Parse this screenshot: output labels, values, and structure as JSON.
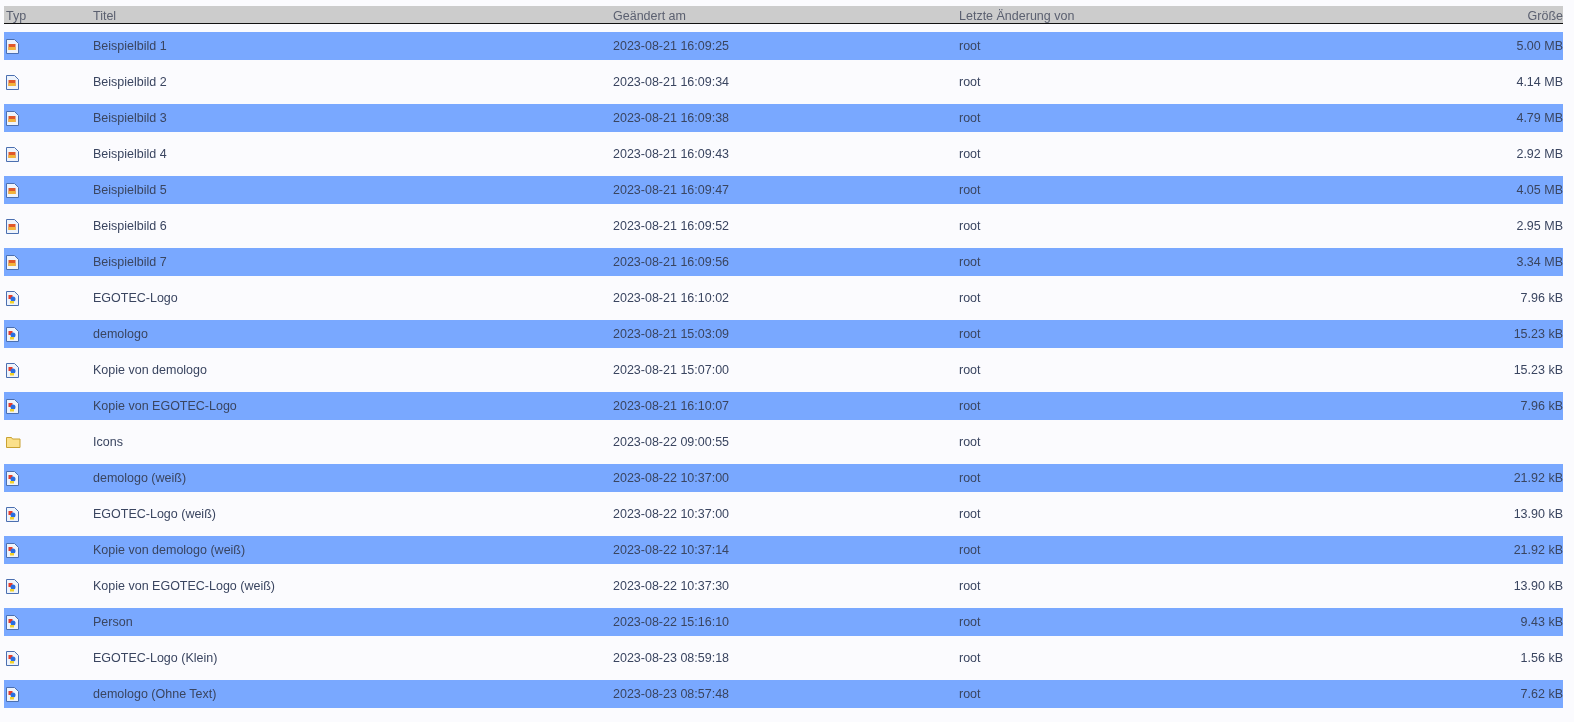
{
  "table": {
    "columns": [
      "Typ",
      "Titel",
      "Geändert am",
      "Letzte Änderung von",
      "Größe"
    ],
    "rows": [
      {
        "kind": "photo",
        "title": "Beispielbild 1",
        "changed": "2023-08-21 16:09:25",
        "by": "root",
        "size": "5.00 MB"
      },
      {
        "kind": "photo",
        "title": "Beispielbild 2",
        "changed": "2023-08-21 16:09:34",
        "by": "root",
        "size": "4.14 MB"
      },
      {
        "kind": "photo",
        "title": "Beispielbild 3",
        "changed": "2023-08-21 16:09:38",
        "by": "root",
        "size": "4.79 MB"
      },
      {
        "kind": "photo",
        "title": "Beispielbild 4",
        "changed": "2023-08-21 16:09:43",
        "by": "root",
        "size": "2.92 MB"
      },
      {
        "kind": "photo",
        "title": "Beispielbild 5",
        "changed": "2023-08-21 16:09:47",
        "by": "root",
        "size": "4.05 MB"
      },
      {
        "kind": "photo",
        "title": "Beispielbild 6",
        "changed": "2023-08-21 16:09:52",
        "by": "root",
        "size": "2.95 MB"
      },
      {
        "kind": "photo",
        "title": "Beispielbild 7",
        "changed": "2023-08-21 16:09:56",
        "by": "root",
        "size": "3.34 MB"
      },
      {
        "kind": "graphic",
        "title": "EGOTEC-Logo",
        "changed": "2023-08-21 16:10:02",
        "by": "root",
        "size": "7.96 kB"
      },
      {
        "kind": "graphic",
        "title": "demologo",
        "changed": "2023-08-21 15:03:09",
        "by": "root",
        "size": "15.23 kB"
      },
      {
        "kind": "graphic",
        "title": "Kopie von demologo",
        "changed": "2023-08-21 15:07:00",
        "by": "root",
        "size": "15.23 kB"
      },
      {
        "kind": "graphic",
        "title": "Kopie von EGOTEC-Logo",
        "changed": "2023-08-21 16:10:07",
        "by": "root",
        "size": "7.96 kB"
      },
      {
        "kind": "folder",
        "title": "Icons",
        "changed": "2023-08-22 09:00:55",
        "by": "root"
      },
      {
        "kind": "graphic",
        "title": "demologo (weiß)",
        "changed": "2023-08-22 10:37:00",
        "by": "root",
        "size": "21.92 kB"
      },
      {
        "kind": "graphic",
        "title": "EGOTEC-Logo (weiß)",
        "changed": "2023-08-22 10:37:00",
        "by": "root",
        "size": "13.90 kB"
      },
      {
        "kind": "graphic",
        "title": "Kopie von demologo (weiß)",
        "changed": "2023-08-22 10:37:14",
        "by": "root",
        "size": "21.92 kB"
      },
      {
        "kind": "graphic",
        "title": "Kopie von EGOTEC-Logo (weiß)",
        "changed": "2023-08-22 10:37:30",
        "by": "root",
        "size": "13.90 kB"
      },
      {
        "kind": "graphic",
        "title": "Person",
        "changed": "2023-08-22 15:16:10",
        "by": "root",
        "size": "9.43 kB"
      },
      {
        "kind": "graphic",
        "title": "EGOTEC-Logo (Klein)",
        "changed": "2023-08-23 08:59:18",
        "by": "root",
        "size": "1.56 kB"
      },
      {
        "kind": "graphic",
        "title": "demologo (Ohne Text)",
        "changed": "2023-08-23 08:57:48",
        "by": "root",
        "size": "7.62 kB"
      }
    ]
  }
}
